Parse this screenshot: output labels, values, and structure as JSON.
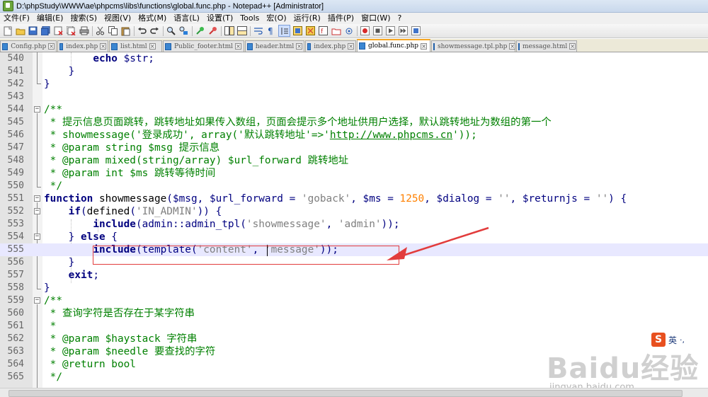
{
  "window": {
    "title": "D:\\phpStudy\\WWW\\ae\\phpcms\\libs\\functions\\global.func.php - Notepad++ [Administrator]"
  },
  "menu": [
    {
      "label": "文件(F)"
    },
    {
      "label": "编辑(E)"
    },
    {
      "label": "搜索(S)"
    },
    {
      "label": "视图(V)"
    },
    {
      "label": "格式(M)"
    },
    {
      "label": "语言(L)"
    },
    {
      "label": "设置(T)"
    },
    {
      "label": "Tools"
    },
    {
      "label": "宏(O)"
    },
    {
      "label": "运行(R)"
    },
    {
      "label": "插件(P)"
    },
    {
      "label": "窗口(W)"
    },
    {
      "label": "?"
    }
  ],
  "tabs": [
    {
      "label": "Config.php"
    },
    {
      "label": "index.php"
    },
    {
      "label": "list.html"
    },
    {
      "label": "Public_footer.html"
    },
    {
      "label": "header.html"
    },
    {
      "label": "index.php"
    },
    {
      "label": "global.func.php"
    },
    {
      "label": "showmessage.tpl.php"
    },
    {
      "label": "message.html"
    }
  ],
  "active_tab_index": 6,
  "editor": {
    "line_numbers": [
      "540",
      "541",
      "542",
      "543",
      "544",
      "545",
      "546",
      "547",
      "548",
      "549",
      "550",
      "551",
      "552",
      "553",
      "554",
      "555",
      "556",
      "557",
      "558",
      "559",
      "560",
      "561",
      "562",
      "563",
      "564",
      "565"
    ]
  },
  "code": {
    "l540_kw": "echo",
    "l540_rest": " $str;",
    "l541": "}",
    "l542": "}",
    "l544": "/**",
    "l545": " * 提示信息页面跳转，跳转地址如果传入数组，页面会提示多个地址供用户选择，默认跳转地址为数组的第一个",
    "l546_a": " * showmessage('登录成功', array('默认跳转地址'=>'",
    "l546_url": "http://www.phpcms.cn",
    "l546_b": "'));",
    "l547": " * @param string $msg 提示信息",
    "l548": " * @param mixed(string/array) $url_forward 跳转地址",
    "l549": " * @param int $ms 跳转等待时间",
    "l550": " */",
    "l551_kw": "function",
    "l551_name": " showmessage",
    "l551_p1": "(",
    "l551_v1": "$msg",
    "l551_c1": ", ",
    "l551_v2": "$url_forward",
    "l551_eq1": " = ",
    "l551_s1": "'goback'",
    "l551_c2": ", ",
    "l551_v3": "$ms",
    "l551_eq2": " = ",
    "l551_n1": "1250",
    "l551_c3": ", ",
    "l551_v4": "$dialog",
    "l551_eq3": " = ",
    "l551_s2": "''",
    "l551_c4": ", ",
    "l551_v5": "$returnjs",
    "l551_eq4": " = ",
    "l551_s3": "''",
    "l551_end": ") {",
    "l552_kw": "if",
    "l552_a": "(",
    "l552_fn": "defined",
    "l552_b": "(",
    "l552_s": "'IN_ADMIN'",
    "l552_c": ")) {",
    "l553_kw": "include",
    "l553_a": "(admin::admin_tpl(",
    "l553_s1": "'showmessage'",
    "l553_c": ", ",
    "l553_s2": "'admin'",
    "l553_d": "));",
    "l554_a": "} ",
    "l554_kw": "else",
    "l554_b": " {",
    "l555_kw": "include",
    "l555_a": "(template(",
    "l555_s1": "'content'",
    "l555_c": ", ",
    "l555_s2": "'message'",
    "l555_d": "));",
    "l556": "}",
    "l557_kw": "exit",
    "l557_b": ";",
    "l558": "}",
    "l559": "/**",
    "l560": " * 查询字符是否存在于某字符串",
    "l561": " *",
    "l562": " * @param $haystack 字符串",
    "l563": " * @param $needle 要查找的字符",
    "l564": " * @return bool",
    "l565": " */"
  },
  "watermark": {
    "logo": "Baidu经验",
    "site": "jingyan.baidu.com"
  },
  "ime": {
    "badge": "S",
    "lang": "英",
    "extra": "·,"
  },
  "colors": {
    "comment": "#008000",
    "keyword": "#00007f",
    "string": "#7f7f7f",
    "number": "#ff8000",
    "annotation": "#e23c3c"
  }
}
